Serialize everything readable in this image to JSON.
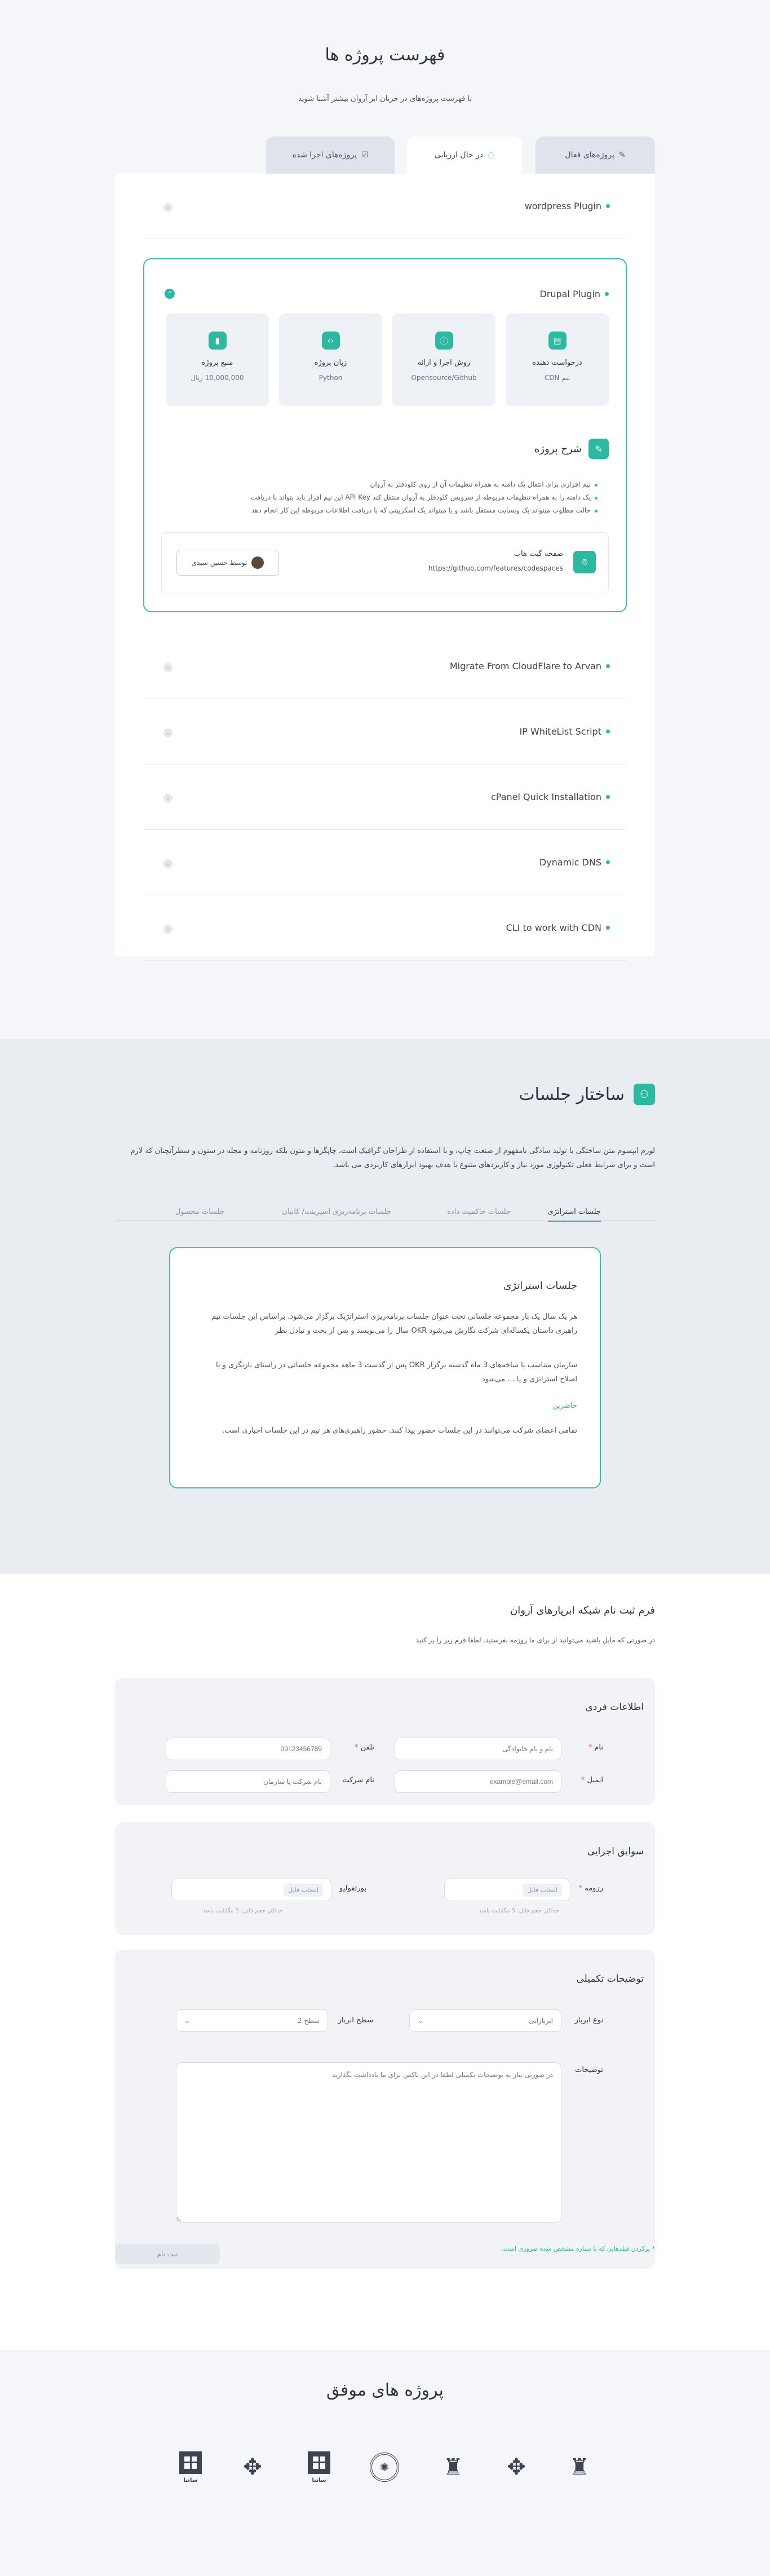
{
  "header": {
    "title": "فهرست پروژه ها",
    "subtitle": "با فهرست پروژه‌های در جریان ابر آروان بیشتر آشنا شوید"
  },
  "tabs": [
    {
      "label": "پروژه‌های فعال",
      "icon": "edit-icon"
    },
    {
      "label": "در حال ارزیابی",
      "icon": "loading-icon"
    },
    {
      "label": "پروژه‌های اجرا شده",
      "icon": "checklist-icon"
    }
  ],
  "projects": [
    {
      "name": "wordpress Plugin"
    },
    {
      "name": "Drupal Plugin"
    },
    {
      "name": "Migrate From CloudFlare to Arvan"
    },
    {
      "name": "IP WhiteList Script"
    },
    {
      "name": "cPanel Quick Installation"
    },
    {
      "name": "Dynamic DNS"
    },
    {
      "name": "CLI to work with CDN"
    }
  ],
  "expanded": {
    "stats": [
      {
        "label": "درخواست دهنده",
        "value": "تیم CDN",
        "icon": "document-icon"
      },
      {
        "label": "روش اجرا و ارائه",
        "value": "Opensource/Github",
        "icon": "info-icon"
      },
      {
        "label": "زبان پروژه",
        "value": "Python",
        "icon": "code-icon"
      },
      {
        "label": "منبع پروژه",
        "value": "10,000,000 ریال",
        "icon": "bookmark-icon"
      }
    ],
    "desc_title": "شرح پروژه",
    "bullets": [
      "نیم افزاری برای انتقال یک دامنه به همراه تنظیمات آن از روی کلودفلر به آروان",
      "یک دامنه را به همراه تنظیمات مربوطه از سرویس کلودفلر به آروان منتقل کند API Key این نیم افزار باید بتواند با دریافت",
      "حالت مطلوب میتواند یک وبسایت مستقل باشد و یا میتواند یک اسکریپتی که با دریافت اطلاعات مربوطه این کار انجام دهد"
    ],
    "github_label": "صفحه گیت هاب",
    "github_url": "https://github.com/features/codespaces",
    "author_label": "توسط حسین سیدی"
  },
  "sessions": {
    "title": "ساختار جلسات",
    "intro": "لورم ایپسوم متن ساختگی با تولید سادگی نامفهوم از صنعت چاپ، و با استفاده از طراحان گرافیک است، چاپگرها و متون بلکه روزنامه و مجله در ستون و سطرآنچنان که لازم است و برای شرایط فعلی تکنولوژی مورد نیاز و کاربردهای متنوع با هدف بهبود ابزارهای کاربردی می باشد.",
    "tabs": [
      "جلسات استراتژی",
      "جلسات حاکمیت داده",
      "جلسات برنامه‌ریزی اسپرینت/ کانبان",
      "جلسات محصول"
    ],
    "card_title": "جلسات استراتژی",
    "p1": "هر یک سال یک بار مجموعه جلسانی تحت عنوان جلسات برنامه‌ریزی استراتژیک برگزار می‌شود. براساس این جلسات تیم راهبری داستان یکساله‌ای شرکت نگارش می‌شود OKR سال را می‌نویسد و پس از بحث و تبادل نظر",
    "p2": "سازمان متناسب با شاخه‌های 3 ماه گذشته برگزار OKR پس از گذشت 3 ماهه مجموعه جلساتی در راستای بازنگری و یا اصلاح استراتژی و یا ... می‌شود",
    "attendees_label": "حاضرین",
    "attendees": "تمامی اعضای شرکت می‌توانند در این جلسات حضور پیدا کنند. حضور راهبری‌های هر تیم در این جلسات اجباری است."
  },
  "form": {
    "title": "فرم ثبت نام شبکه ابرپارهای آروان",
    "subtitle": "در صورتی که مایل باشید می‌توانید از برای ما روزمه بفرستید. لطفا فرم زیر را پر کنید",
    "personal": {
      "title": "اطلاعات فردی",
      "name_label": "نام",
      "name_ph": "نام و نام خانوادگی",
      "phone_label": "تلفن",
      "phone_ph": "09123456789",
      "email_label": "ایمیل",
      "email_ph": "example@email.com",
      "company_label": "نام شرکت",
      "company_ph": "نام شرکت یا سازمان"
    },
    "history": {
      "title": "سوابق اجرایی",
      "resume_label": "رزومه",
      "resume_btn": "انتخاب فایل",
      "resume_hint": "حداکثر حجم فایل: 5 مگابایت باشد",
      "portfolio_label": "پورتفولیو",
      "portfolio_btn": "انتخاب فایل",
      "portfolio_hint": "حداکثر حجم فایل: 5 مگابایت باشد"
    },
    "extra": {
      "title": "توضیحات تکمیلی",
      "type_label": "نوع ابرباز",
      "type_value": "ابربازانی",
      "level_label": "سطح ابرباز",
      "level_value": "سطح 2",
      "notes_label": "توضیحات",
      "notes_ph": "در صورتی نیاز به توضیحات تکمیلی لطفا در این باکس برای ما یادداشت بگذارید"
    },
    "note": "* پرکردن فیلدهایی که با ستاره مشخص شده ضروری است.",
    "submit": "ثبت نام"
  },
  "success": {
    "title": "پروژه های موفق",
    "logos": [
      "ساتنا",
      "ساتنا",
      "ساتنا"
    ]
  },
  "colors": {
    "accent": "#2db8a2",
    "bg": "#f4f6fa"
  }
}
